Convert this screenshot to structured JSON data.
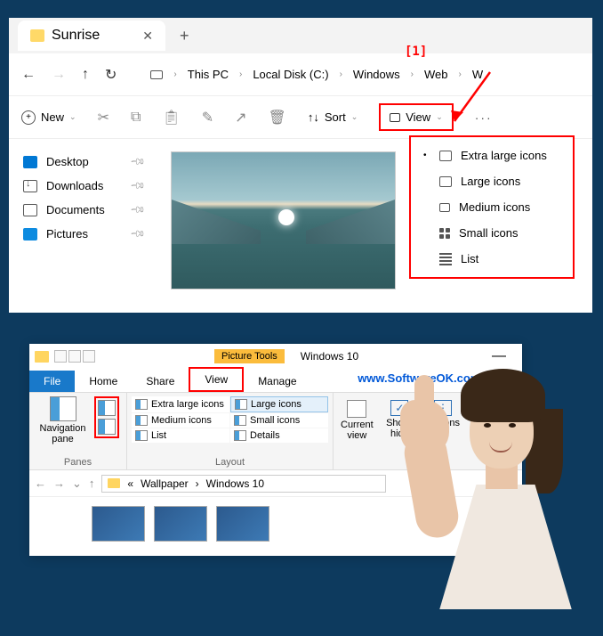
{
  "annotation": {
    "marker": "[1]"
  },
  "win11": {
    "tab_title": "Sunrise",
    "breadcrumb": [
      "This PC",
      "Local Disk (C:)",
      "Windows",
      "Web",
      "W"
    ],
    "toolbar": {
      "new": "New",
      "sort": "Sort",
      "view": "View"
    },
    "sidebar": [
      {
        "label": "Desktop"
      },
      {
        "label": "Downloads"
      },
      {
        "label": "Documents"
      },
      {
        "label": "Pictures"
      }
    ],
    "view_menu": [
      "Extra large icons",
      "Large icons",
      "Medium icons",
      "Small icons",
      "List"
    ]
  },
  "win10": {
    "picture_tools": "Picture Tools",
    "title": "Windows 10",
    "watermark": "www.SoftwareOK.com :-)",
    "tabs": {
      "file": "File",
      "home": "Home",
      "share": "Share",
      "view": "View",
      "manage": "Manage"
    },
    "ribbon": {
      "navpane": "Navigation pane",
      "panes_label": "Panes",
      "layout": {
        "xl": "Extra large icons",
        "lg": "Large icons",
        "md": "Medium icons",
        "sm": "Small icons",
        "list": "List",
        "details": "Details"
      },
      "layout_label": "Layout",
      "current_view": "Current view",
      "show_hide": "Show/ hide",
      "options": "Options"
    },
    "address": [
      "Wallpaper",
      "Windows 10"
    ]
  }
}
